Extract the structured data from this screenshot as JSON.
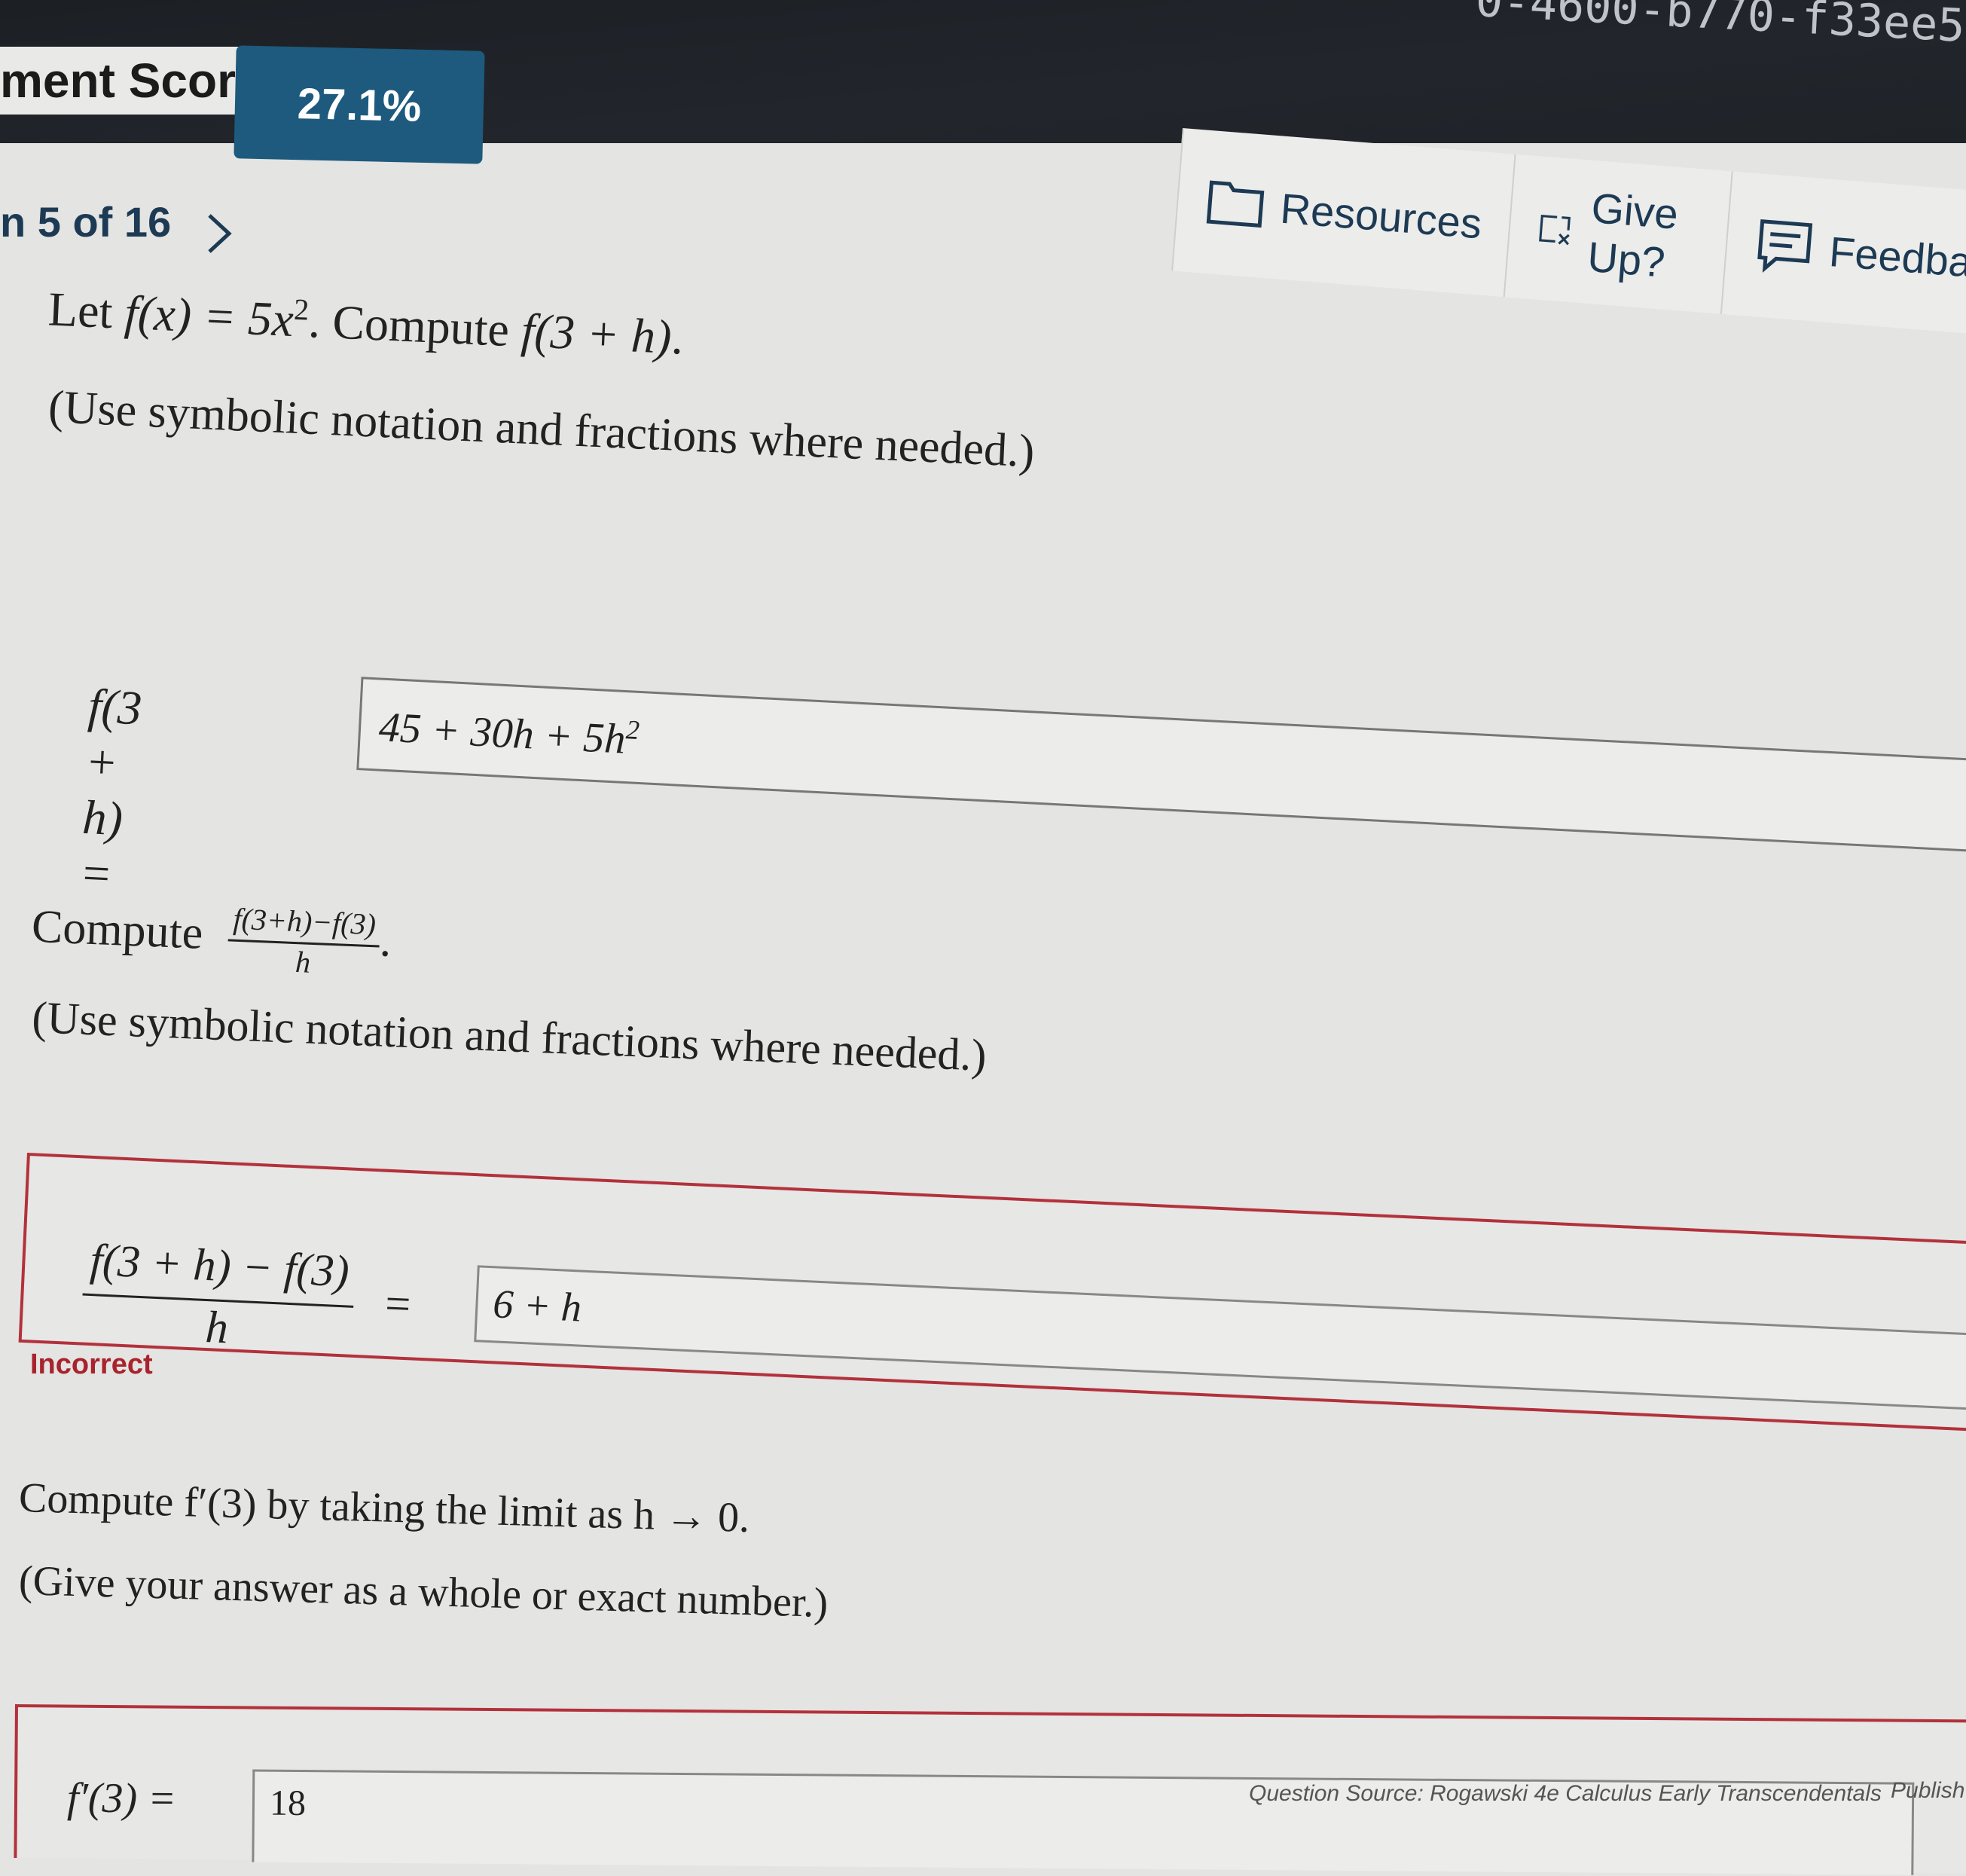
{
  "header": {
    "session_id_fragment": "0-4600-b770-f33ee5",
    "score_label": "ment Score:",
    "score_value": "27.1%"
  },
  "pager": {
    "text": "n 5 of 16"
  },
  "toolbar": {
    "resources_label": "Resources",
    "giveup_label": "Give Up?",
    "feedback_label": "Feedbac"
  },
  "question1": {
    "prompt_lead": "Let ",
    "prompt_math": "f(x) = 5x",
    "prompt_sup": "2",
    "prompt_mid": ". Compute ",
    "prompt_target": "f(3 + h)",
    "prompt_end": ".",
    "note": "(Use symbolic notation and fractions where needed.)",
    "answer_label": "f(3 + h) =",
    "answer_value": "45 + 30h + 5h",
    "answer_sup": "2"
  },
  "question2": {
    "prompt_lead": "Compute",
    "frac_num": "f(3+h)−f(3)",
    "frac_den": "h",
    "prompt_end": ".",
    "note": "(Use symbolic notation and fractions where needed.)",
    "answer_num": "f(3 + h) − f(3)",
    "answer_den": "h",
    "answer_eq": "=",
    "answer_value": "6 + h",
    "status": "Incorrect"
  },
  "question3": {
    "prompt": "Compute f′(3) by taking the limit as h → 0.",
    "note": "(Give your answer as a whole or exact number.)",
    "answer_label": "f′(3) =",
    "answer_value": "18"
  },
  "footer": {
    "source": "Question Source: Rogawski 4e Calculus Early Transcendentals",
    "publisher": "Publish"
  }
}
